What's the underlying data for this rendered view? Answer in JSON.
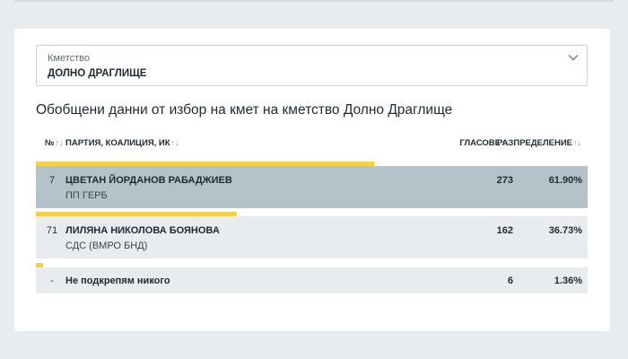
{
  "select": {
    "label": "Кметство",
    "value": "ДОЛНО ДРАГЛИЩЕ"
  },
  "heading": "Обобщени данни от избор на кмет на кметство Долно Драглище",
  "table": {
    "headers": {
      "number": "№",
      "party": "ПАРТИЯ, КОАЛИЦИЯ, ИК",
      "votes": "ГЛАСОВЕ",
      "distribution": "РАЗПРЕДЕЛЕНИЕ",
      "sort_glyph": "↑↓"
    },
    "rows": [
      {
        "number": "7",
        "name": "ЦВЕТАН ЙОРДАНОВ РАБАДЖИЕВ",
        "party": "ПП ГЕРБ",
        "votes": "273",
        "percent": "61.90%",
        "share": 0.619
      },
      {
        "number": "71",
        "name": "ЛИЛЯНА НИКОЛОВА БОЯНОВА",
        "party": "СДС (ВМРО БНД)",
        "votes": "162",
        "percent": "36.73%",
        "share": 0.3673
      },
      {
        "number": "-",
        "name": "Не подкрепям никого",
        "party": "",
        "votes": "6",
        "percent": "1.36%",
        "share": 0.0136
      }
    ]
  },
  "colors": {
    "accent_bar": "#f7d046",
    "highlight_row": "#b4c3c9",
    "row_bg": "#e8ecef"
  }
}
